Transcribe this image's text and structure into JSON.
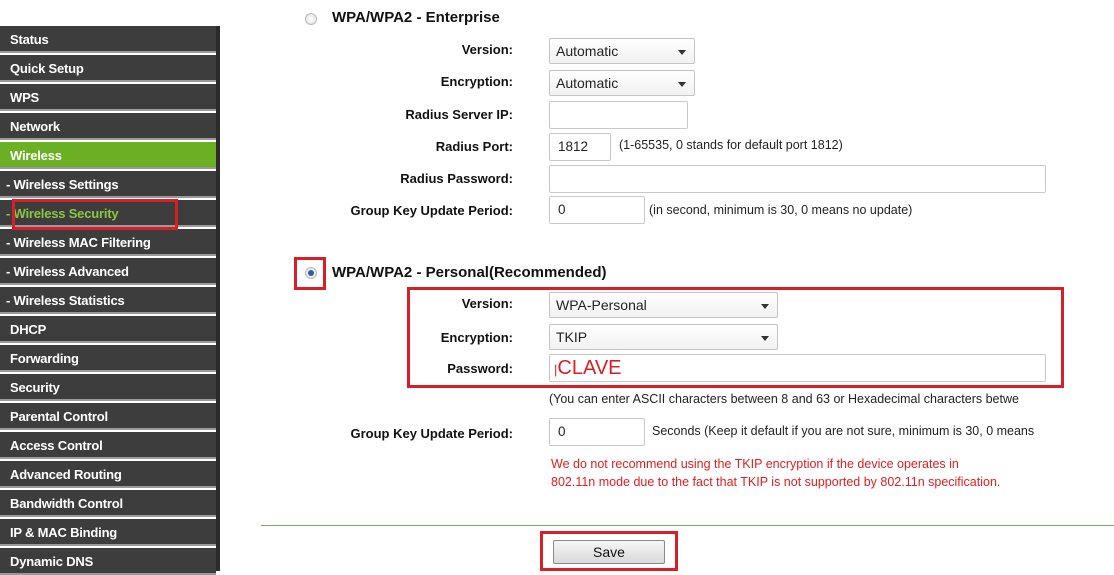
{
  "sidebar": {
    "items": [
      {
        "label": "Status"
      },
      {
        "label": "Quick Setup"
      },
      {
        "label": "WPS"
      },
      {
        "label": "Network"
      },
      {
        "label": "Wireless"
      },
      {
        "label": "- Wireless Settings"
      },
      {
        "label": "- Wireless Security"
      },
      {
        "label": "- Wireless MAC Filtering"
      },
      {
        "label": "- Wireless Advanced"
      },
      {
        "label": "- Wireless Statistics"
      },
      {
        "label": "DHCP"
      },
      {
        "label": "Forwarding"
      },
      {
        "label": "Security"
      },
      {
        "label": "Parental Control"
      },
      {
        "label": "Access Control"
      },
      {
        "label": "Advanced Routing"
      },
      {
        "label": "Bandwidth Control"
      },
      {
        "label": "IP & MAC Binding"
      },
      {
        "label": "Dynamic DNS"
      }
    ]
  },
  "enterprise": {
    "title": "WPA/WPA2 - Enterprise",
    "selected": false,
    "version_label": "Version:",
    "version_value": "Automatic",
    "encryption_label": "Encryption:",
    "encryption_value": "Automatic",
    "radius_ip_label": "Radius Server IP:",
    "radius_ip_value": "",
    "radius_port_label": "Radius Port:",
    "radius_port_value": "1812",
    "radius_port_hint": "(1-65535, 0 stands for default port 1812)",
    "radius_password_label": "Radius Password:",
    "radius_password_value": "",
    "group_key_label": "Group Key Update Period:",
    "group_key_value": "0",
    "group_key_hint": "(in second, minimum is 30, 0 means no update)"
  },
  "personal": {
    "title": "WPA/WPA2 - Personal(Recommended)",
    "selected": true,
    "version_label": "Version:",
    "version_value": "WPA-Personal",
    "encryption_label": "Encryption:",
    "encryption_value": "TKIP",
    "password_label": "Password:",
    "password_value": "CLAVE",
    "password_hint": "(You can enter ASCII characters between 8 and 63 or Hexadecimal characters betwe",
    "group_key_label": "Group Key Update Period:",
    "group_key_value": "0",
    "group_key_hint": "Seconds (Keep it default if you are not sure, minimum is 30, 0 means",
    "warning_line1": "We do not recommend using the TKIP encryption if the device operates in",
    "warning_line2": "802.11n mode due to the fact that TKIP is not supported by 802.11n specification."
  },
  "actions": {
    "save_label": "Save"
  },
  "colors": {
    "highlight": "#d61f26",
    "nav_active": "#6ab022",
    "nav_bg": "#3d3d3d",
    "warning": "#e02020"
  }
}
